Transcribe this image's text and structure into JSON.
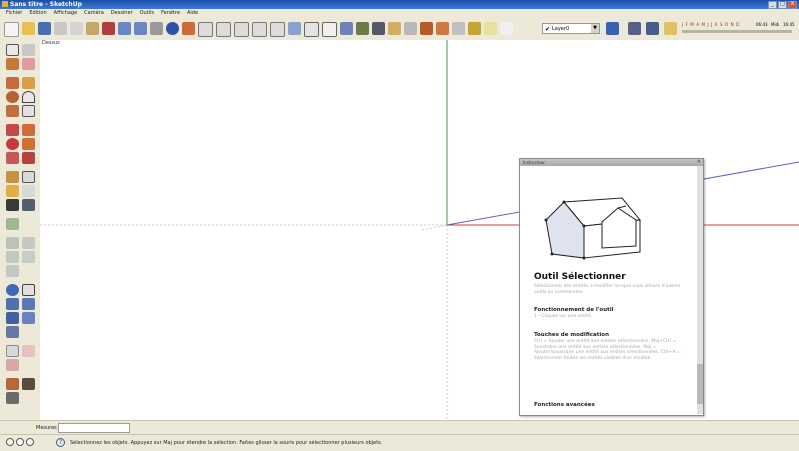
{
  "window": {
    "title": "Sans titre - SketchUp",
    "controls": [
      "_",
      "□",
      "X"
    ]
  },
  "menu": [
    "Fichier",
    "Edition",
    "Affichage",
    "Caméra",
    "Dessiner",
    "Outils",
    "Fenêtre",
    "Aide"
  ],
  "toolbar": {
    "layer_select": {
      "value": "Layer0"
    },
    "shadow": {
      "months": "J F M A M J J A S O N D",
      "time_start": "06:43",
      "time_mid": "Midi",
      "time_end": "16:45"
    }
  },
  "viewport": {
    "label": "Dessus",
    "axis_colors": {
      "green": "#3fa24a",
      "red": "#d83a3a",
      "blue": "#5b63c9"
    }
  },
  "instructor": {
    "title": "Instructeur",
    "tool_title": "Outil Sélectionner",
    "description": "Sélectionner des entités à modifier lorsque vous utilisez d'autres outils ou commandes.",
    "sections": [
      {
        "heading": "Fonctionnement de l'outil",
        "text": "1 - Cliquez sur une entité."
      },
      {
        "heading": "Touches de modification",
        "text": "Ctrl = Ajouter une entité aux entités sélectionnées. Maj+Ctrl = Soustraire une entité aux entités sélectionnées. Maj = Ajouter/soustraire une entité aux entités sélectionnées. Ctrl+A = Sélectionner toutes les entités visibles d'un modèle."
      },
      {
        "heading": "Fonctions avancées",
        "text": ""
      }
    ]
  },
  "measure": {
    "label": "Mesures",
    "value": ""
  },
  "status": {
    "text": "Sélectionnez les objets. Appuyez sur Maj pour étendre la sélection. Faites glisser la souris pour sélectionner plusieurs objets."
  }
}
